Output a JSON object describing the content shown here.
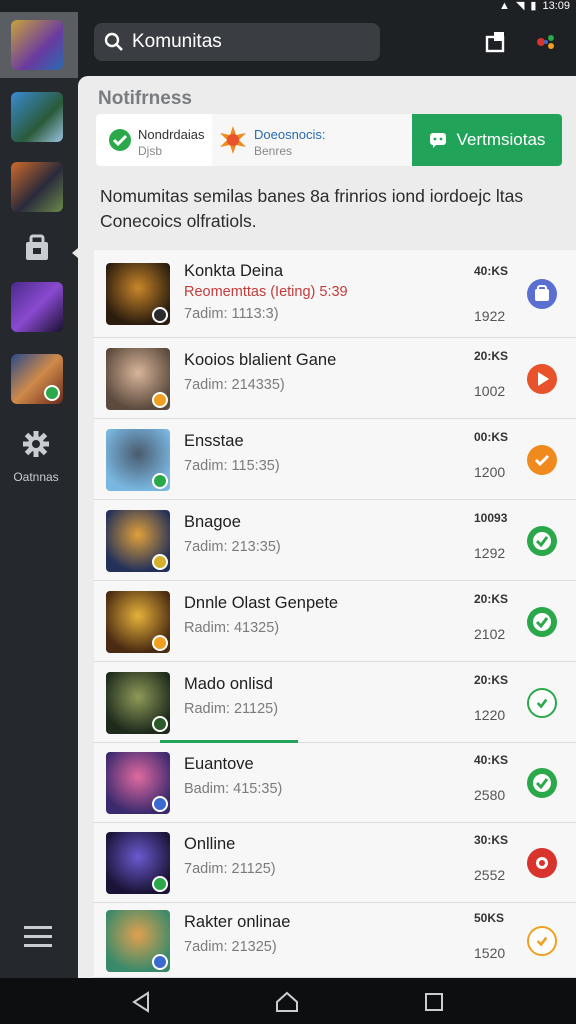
{
  "status": {
    "time": "13:09"
  },
  "search": {
    "text": "Komunitas"
  },
  "rail": {
    "settings_label": "Oatnnas"
  },
  "panel": {
    "title": "Notifrness",
    "tabs": [
      {
        "line1": "Nondrdaias",
        "line2": "Djsb"
      },
      {
        "line1": "Doeosnocis:",
        "line2": "Benres"
      },
      {
        "label": "Vertmsiotas"
      }
    ],
    "description": "Nomumitas semilas banes 8a frinrios iond iordoejc ltas Conecoics olfratiols."
  },
  "items": [
    {
      "title": "Konkta Deina",
      "extra": "Reomemttas (Ieting) 5:39",
      "sub": "7adim: 1113:3)",
      "size": "40:KS",
      "num": "1922",
      "btn_color": "#5a6fd0",
      "btn_icon": "bag-icon",
      "art": [
        "#2b1d0e",
        "#c9862a"
      ],
      "badge_color": "#2b2b2b"
    },
    {
      "title": "Kooios blalient Gane",
      "extra": "",
      "sub": "7adim: 214335)",
      "size": "20:KS",
      "num": "1002",
      "btn_color": "#e8532c",
      "btn_icon": "play-icon",
      "art": [
        "#5b4a3d",
        "#d8b59a"
      ],
      "badge_color": "#f0a020"
    },
    {
      "title": "Ensstae",
      "extra": "",
      "sub": "7adim: 115:35)",
      "size": "00:KS",
      "num": "1200",
      "btn_color": "#f08a1e",
      "btn_icon": "check-icon",
      "art": [
        "#79b6e0",
        "#4a5b6e"
      ],
      "badge_color": "#2aa84a"
    },
    {
      "title": "Bnagoe",
      "extra": "",
      "sub": "7adim: 213:35)",
      "size": "10093",
      "num": "1292",
      "btn_color": "#2aa84a",
      "btn_icon": "check-ring-icon",
      "art": [
        "#233159",
        "#e0a03a"
      ],
      "badge_color": "#d4b12a"
    },
    {
      "title": "Dnnle Olast Genpete",
      "extra": "",
      "sub": "Radim: 41325)",
      "size": "20:KS",
      "num": "2102",
      "btn_color": "#2aa84a",
      "btn_icon": "check-ring-icon",
      "art": [
        "#4a2a12",
        "#e6b23a"
      ],
      "badge_color": "#f0a020"
    },
    {
      "title": "Mado onlisd",
      "extra": "",
      "sub": "Radim: 21125)",
      "size": "20:KS",
      "num": "1220",
      "btn_color": "#2aa84a",
      "btn_icon": "check-outline-icon",
      "art": [
        "#1d2a1c",
        "#8e9a58"
      ],
      "badge_color": "#2b5a2b"
    },
    {
      "title": "Euantove",
      "extra": "",
      "sub": "Badim: 415:35)",
      "size": "40:KS",
      "num": "2580",
      "btn_color": "#2aa84a",
      "btn_icon": "check-ring-icon",
      "art": [
        "#3c2a6e",
        "#e06aa0"
      ],
      "badge_color": "#3a6ad0"
    },
    {
      "title": "Onlline",
      "extra": "",
      "sub": "7adim: 21125)",
      "size": "30:KS",
      "num": "2552",
      "btn_color": "#d8332c",
      "btn_icon": "record-icon",
      "art": [
        "#1b1436",
        "#6a5ad0"
      ],
      "badge_color": "#2aa84a"
    },
    {
      "title": "Rakter onlinae",
      "extra": "",
      "sub": "7adim: 21325)",
      "size": "50KS",
      "num": "1520",
      "btn_color": "#f0a020",
      "btn_icon": "check-outline-icon",
      "art": [
        "#3a8a6a",
        "#e0a050"
      ],
      "badge_color": "#3a6ad0"
    }
  ]
}
